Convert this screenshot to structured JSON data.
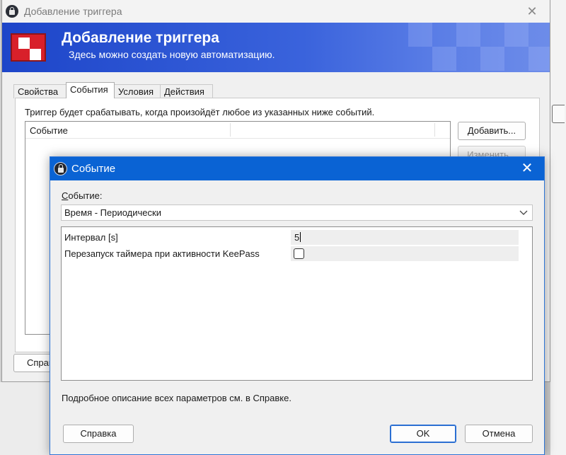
{
  "parent_window": {
    "title": "Добавление триггера",
    "close_glyph": "✕",
    "banner": {
      "title": "Добавление триггера",
      "subtitle": "Здесь можно создать новую автоматизацию."
    },
    "tabs": [
      {
        "label": "Свойства",
        "active": false
      },
      {
        "label": "События",
        "active": true
      },
      {
        "label": "Условия",
        "active": false
      },
      {
        "label": "Действия",
        "active": false
      }
    ],
    "description": "Триггер будет срабатывать, когда произойдёт любое из указанных ниже событий.",
    "list": {
      "column_header": "Событие"
    },
    "buttons": {
      "add": "Добавить...",
      "edit": "Изменить...",
      "help_partial": "Справ"
    }
  },
  "dialog": {
    "title": "Событие",
    "close_glyph": "✕",
    "event_label_prefix": "",
    "event_label_underlined": "С",
    "event_label_rest": "обытие:",
    "event_selected": "Время - Периодически",
    "properties": [
      {
        "label": "Интервал [s]",
        "type": "text",
        "value": "5"
      },
      {
        "label": "Перезапуск таймера при активности KeePass",
        "type": "checkbox",
        "checked": false
      }
    ],
    "help_text": "Подробное описание всех параметров см. в Справке.",
    "buttons": {
      "help": "Справка",
      "ok": "OK",
      "cancel": "Отмена"
    }
  },
  "colors": {
    "dialog_titlebar": "#0a63d4",
    "banner_start": "#1d45c9",
    "banner_end": "#6d8ce9",
    "logo_red": "#d8202a"
  },
  "icons": {
    "app": "keepass-lock-icon",
    "banner_logo": "trigger-logo-icon",
    "dropdown": "chevron-down-icon",
    "close": "close-icon"
  }
}
